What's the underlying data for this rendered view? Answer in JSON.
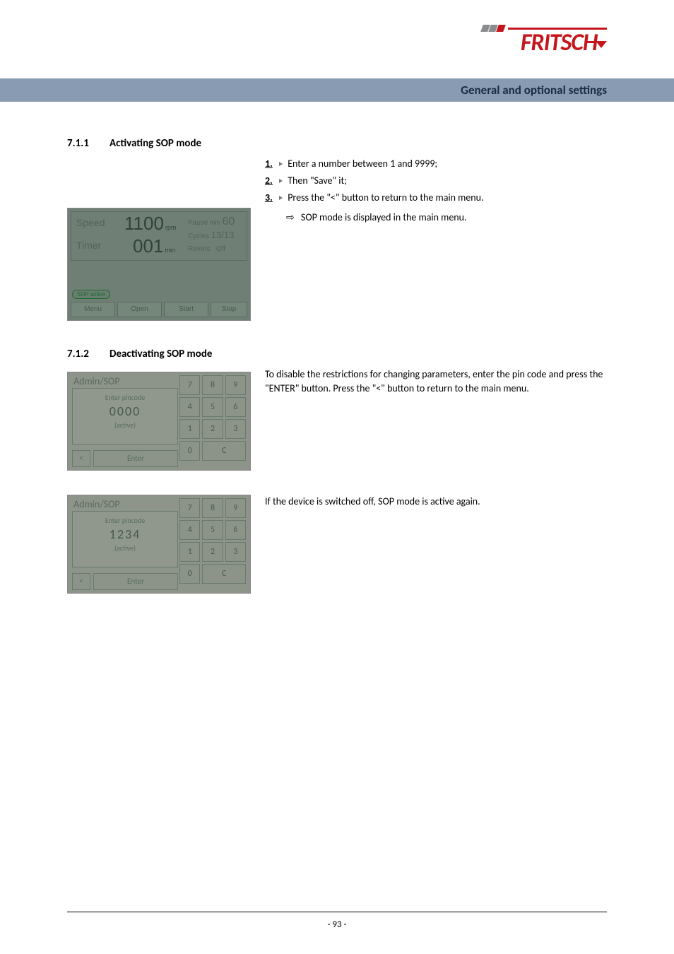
{
  "brand": "FRITSCH",
  "band_title": "General and optional settings",
  "sections": {
    "s1": {
      "num": "7.1.1",
      "title": "Activating SOP mode"
    },
    "s2": {
      "num": "7.1.2",
      "title": "Deactivating SOP mode"
    }
  },
  "steps": {
    "n1": "1.",
    "t1": "Enter a number between 1 and 9999;",
    "n2": "2.",
    "t2": "Then \"Save\" it;",
    "n3": "3.",
    "t3": "Press the \"<\" button to return to the main menu.",
    "result_icon": "⇨",
    "result": "SOP mode is displayed in the main menu."
  },
  "lcd": {
    "speed_label": "Speed",
    "speed_value": "1100",
    "speed_unit": "rpm",
    "timer_label": "Timer",
    "timer_value": "001",
    "timer_unit": "min",
    "pause_label": "Pause",
    "pause_unit": "min",
    "pause_value": "60",
    "cycles_label": "Cycles",
    "cycles_value": "13/13",
    "revers_label": "Revers",
    "revers_value": "Off",
    "sop_active": "SOP active",
    "buttons": {
      "menu": "Menu",
      "open": "Open",
      "start": "Start",
      "stop": "Stop"
    }
  },
  "keypad": {
    "title": "Admin/SOP",
    "msg1": "Enter pincode",
    "msg2": "(active)",
    "value_a": "0000",
    "value_b": "1234",
    "back_label": "<",
    "enter_label": "Enter",
    "keys": {
      "k7": "7",
      "k8": "8",
      "k9": "9",
      "k4": "4",
      "k5": "5",
      "k6": "6",
      "k1": "1",
      "k2": "2",
      "k3": "3",
      "k0": "0",
      "kc": "C"
    }
  },
  "paras": {
    "deact": "To disable the restrictions for changing parameters, enter the pin code and press the \"ENTER\" button. Press the \"<\" button to return to the main menu.",
    "switched_off": "If the device is switched off, SOP mode is active again."
  },
  "page_number": "- 93 -"
}
